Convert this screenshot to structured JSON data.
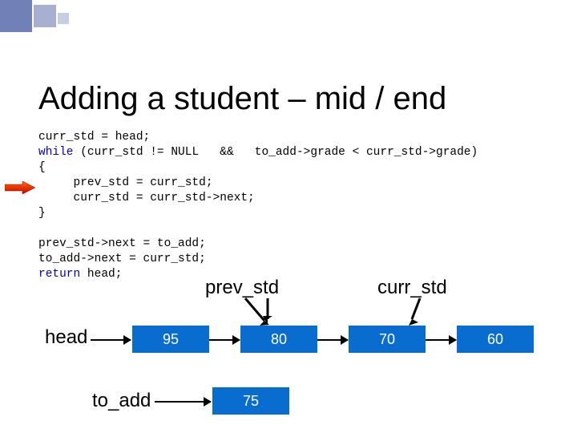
{
  "slide": {
    "title": "Adding a student – mid / end"
  },
  "code": {
    "line1a": "curr_std = head;",
    "line2_kw": "while",
    "line2a": " (curr_std != NULL   &&   to_add->grade < curr_std->grade)",
    "line3": "{",
    "line4": "     prev_std = curr_std;",
    "line5": "     curr_std = curr_std->next;",
    "line6": "}",
    "blank": "",
    "line7": "prev_std->next = to_add;",
    "line8": "to_add->next = curr_std;",
    "line9_kw": "return",
    "line9a": " head;"
  },
  "labels": {
    "prev": "prev_std",
    "curr": "curr_std",
    "head": "head",
    "toadd": "to_add"
  },
  "nodes": {
    "n95": "95",
    "n80": "80",
    "n70": "70",
    "n60": "60",
    "n75": "75"
  },
  "chart_data": {
    "type": "table",
    "description": "Linked list diagram for insertion of node 75",
    "list_values": [
      95,
      80,
      70,
      60
    ],
    "insert_value": 75,
    "pointers": {
      "head": 95,
      "prev_std": 80,
      "curr_std": 70,
      "to_add": 75
    }
  }
}
